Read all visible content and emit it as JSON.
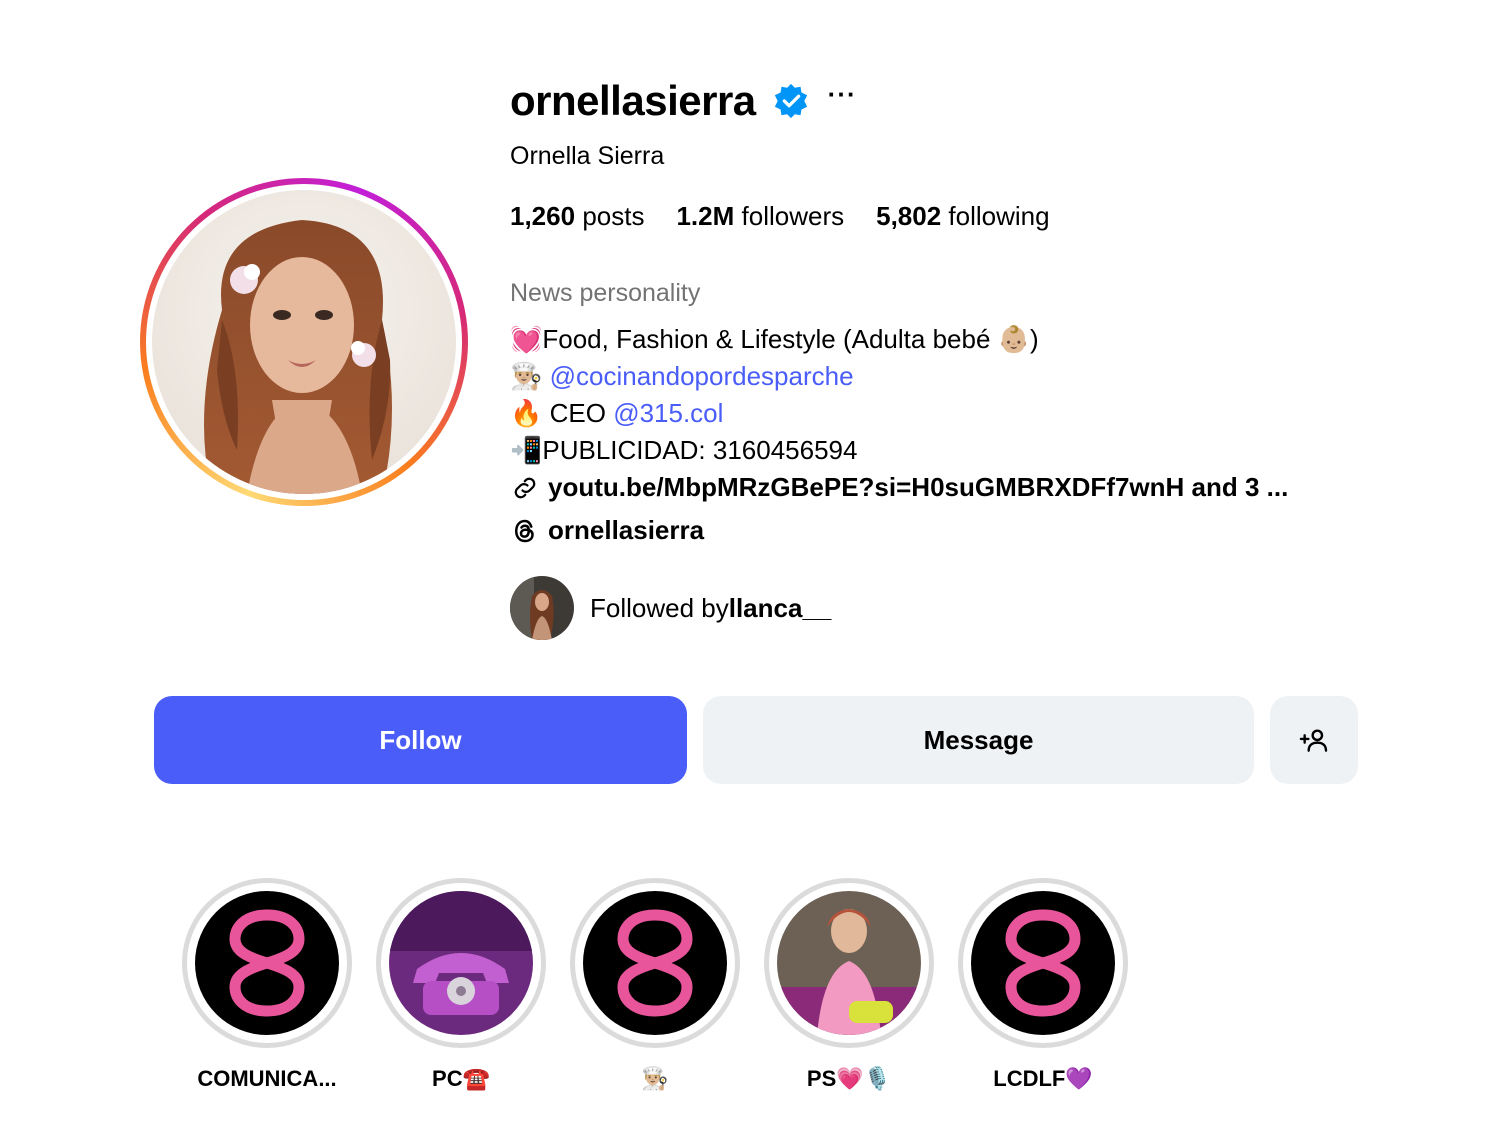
{
  "profile": {
    "username": "ornellasierra",
    "full_name": "Ornella Sierra",
    "verified_icon": "verified-badge-icon",
    "more_label": "···"
  },
  "stats": {
    "posts_count": "1,260",
    "posts_label": "posts",
    "followers_count": "1.2M",
    "followers_label": "followers",
    "following_count": "5,802",
    "following_label": "following"
  },
  "bio": {
    "category": "News personality",
    "line1_emoji": "💓",
    "line1_text": "Food, Fashion & Lifestyle (Adulta bebé ",
    "line1_emoji2": "👶🏼",
    "line1_end": ")",
    "line2_emoji": "👨🏼‍🍳",
    "line2_link": "@cocinandopordesparche",
    "line3_emoji": "🔥",
    "line3_text": "CEO ",
    "line3_link": "@315.col",
    "line4_emoji": "📲",
    "line4_text": "PUBLICIDAD: 3160456594",
    "external_link": "youtu.be/MbpMRzGBePE?si=H0suGMBRXDFf7wnH and 3 ...",
    "threads_handle": "ornellasierra"
  },
  "followed_by": {
    "prefix": "Followed by ",
    "user": "llanca__"
  },
  "actions": {
    "follow_label": "Follow",
    "message_label": "Message",
    "add_icon": "add-person-icon"
  },
  "highlights": [
    {
      "label": "COMUNICA..."
    },
    {
      "label": "PC☎️"
    },
    {
      "label": "👨🏼‍🍳"
    },
    {
      "label": "PS💗🎙️"
    },
    {
      "label": "LCDLF💜"
    }
  ],
  "colors": {
    "accent": "#4a5df9",
    "secondary_button": "#eff2f5",
    "muted_text": "#737373",
    "verified": "#0095f6",
    "highlight_pink": "#e8559a"
  }
}
